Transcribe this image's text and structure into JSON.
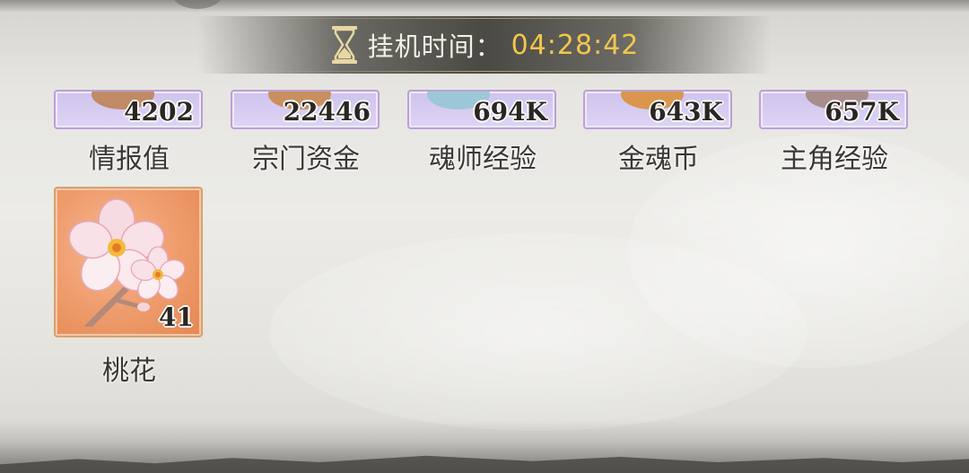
{
  "header": {
    "label": "挂机时间：",
    "time": "04:28:42",
    "icon": "hourglass-icon"
  },
  "items": [
    {
      "name": "情报值",
      "count": "4202",
      "rarity": "purple"
    },
    {
      "name": "宗门资金",
      "count": "22446",
      "rarity": "purple"
    },
    {
      "name": "魂师经验",
      "count": "694K",
      "rarity": "purple"
    },
    {
      "name": "金魂币",
      "count": "643K",
      "rarity": "purple"
    },
    {
      "name": "主角经验",
      "count": "657K",
      "rarity": "purple"
    },
    {
      "name": "桃花",
      "count": "41",
      "rarity": "orange",
      "icon": "peach-blossom-icon"
    }
  ],
  "colors": {
    "time": "#f1c74c",
    "label": "#f3efe6",
    "item_text": "#3a3834"
  }
}
